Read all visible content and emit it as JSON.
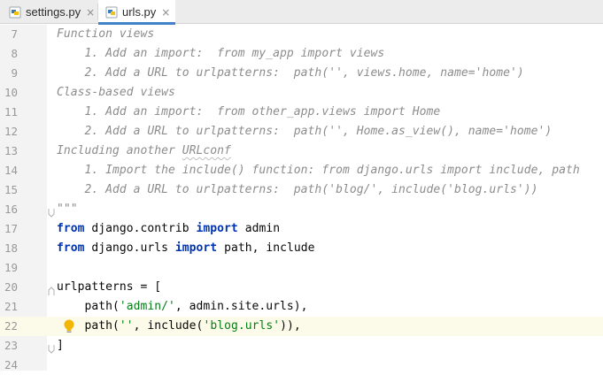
{
  "tabs": [
    {
      "label": "settings.py",
      "active": false,
      "closable": true,
      "icon": "python-file-icon"
    },
    {
      "label": "urls.py",
      "active": true,
      "closable": true,
      "icon": "python-file-icon"
    }
  ],
  "close_glyph": "×",
  "colors": {
    "keyword": "#0033b3",
    "string": "#067d17",
    "docstring": "#8c8c8c",
    "current_line": "#fcfae8",
    "tab_underline": "#4083c9"
  },
  "editor": {
    "current_line": 22,
    "lines": [
      {
        "num": "7",
        "text": "Function views"
      },
      {
        "num": "8",
        "text": "    1. Add an import:  from my_app import views"
      },
      {
        "num": "9",
        "text": "    2. Add a URL to urlpatterns:  path('', views.home, name='home')"
      },
      {
        "num": "10",
        "text": "Class-based views"
      },
      {
        "num": "11",
        "text": "    1. Add an import:  from other_app.views import Home"
      },
      {
        "num": "12",
        "text": "    2. Add a URL to urlpatterns:  path('', Home.as_view(), name='home')"
      },
      {
        "num": "13",
        "text_pre": "Including another ",
        "text_squiggle": "URLconf"
      },
      {
        "num": "14",
        "text": "    1. Import the include() function: from django.urls import include, path"
      },
      {
        "num": "15",
        "text": "    2. Add a URL to urlpatterns:  path('blog/', include('blog.urls'))"
      },
      {
        "num": "16",
        "text": "\"\"\""
      },
      {
        "num": "17",
        "kw1": "from",
        "mid": " django.contrib ",
        "kw2": "import",
        "tail": " admin"
      },
      {
        "num": "18",
        "kw1": "from",
        "mid": " django.urls ",
        "kw2": "import",
        "tail": " path, include"
      },
      {
        "num": "19",
        "text": ""
      },
      {
        "num": "20",
        "text": "urlpatterns = ["
      },
      {
        "num": "21",
        "pre": "    path(",
        "str": "'admin/'",
        "post": ", admin.site.urls),"
      },
      {
        "num": "22",
        "pre": "    path(",
        "str": "''",
        "mid": ", include(",
        "str2": "'blog.urls'",
        "post": ")),"
      },
      {
        "num": "23",
        "text": "]"
      },
      {
        "num": "24",
        "text": ""
      }
    ]
  }
}
